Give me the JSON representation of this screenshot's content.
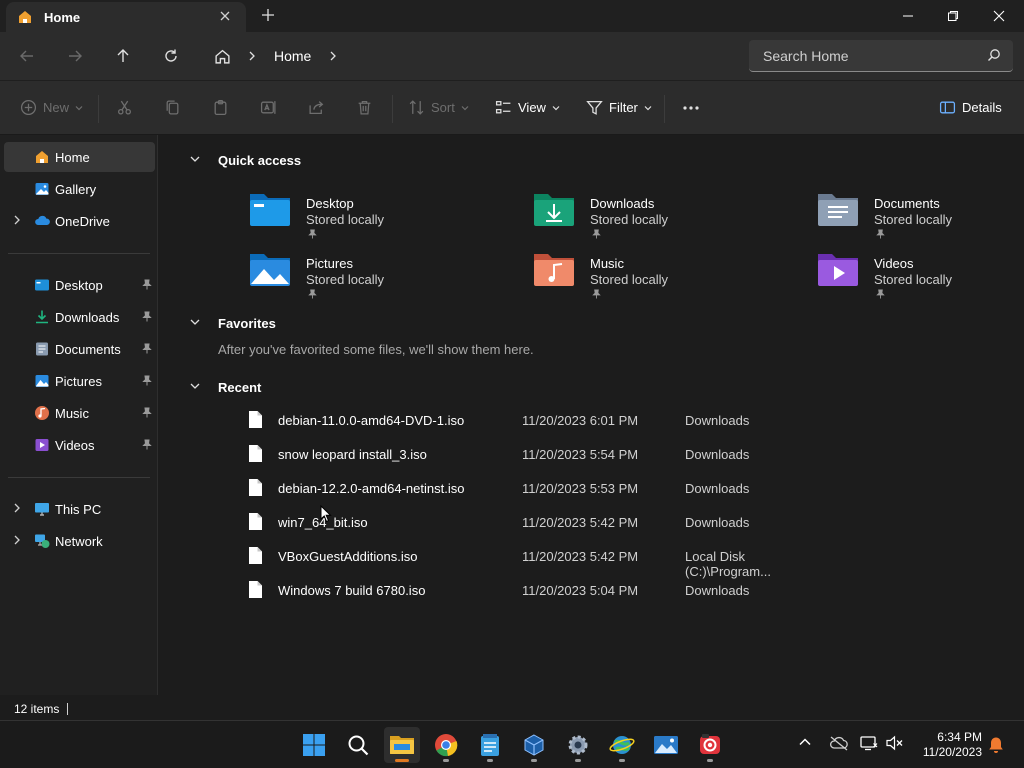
{
  "window": {
    "tab_title": "Home",
    "minimize_label": "",
    "maximize_label": "",
    "close_label": ""
  },
  "address": {
    "breadcrumb_home": "Home",
    "search_placeholder": "Search Home"
  },
  "commands": {
    "new": "New",
    "sort": "Sort",
    "view": "View",
    "filter": "Filter",
    "details": "Details"
  },
  "sidebar": {
    "top": [
      {
        "label": "Home",
        "icon": "home-icon",
        "selected": true
      },
      {
        "label": "Gallery",
        "icon": "gallery-icon"
      },
      {
        "label": "OneDrive",
        "icon": "cloud-icon"
      }
    ],
    "pinned": [
      {
        "label": "Desktop",
        "icon": "desktop-folder-icon"
      },
      {
        "label": "Downloads",
        "icon": "downloads-folder-icon"
      },
      {
        "label": "Documents",
        "icon": "documents-folder-icon"
      },
      {
        "label": "Pictures",
        "icon": "pictures-folder-icon"
      },
      {
        "label": "Music",
        "icon": "music-folder-icon"
      },
      {
        "label": "Videos",
        "icon": "videos-folder-icon"
      }
    ],
    "bottom": [
      {
        "label": "This PC",
        "icon": "computer-icon"
      },
      {
        "label": "Network",
        "icon": "network-icon"
      }
    ]
  },
  "quick_access": {
    "heading": "Quick access",
    "items": [
      {
        "name": "Desktop",
        "status": "Stored locally",
        "icon": "desktop-folder-icon",
        "color": "#1e8fd8"
      },
      {
        "name": "Downloads",
        "status": "Stored locally",
        "icon": "downloads-folder-icon",
        "color": "#1aa37a"
      },
      {
        "name": "Documents",
        "status": "Stored locally",
        "icon": "documents-folder-icon",
        "color": "#8a9bb0"
      },
      {
        "name": "Pictures",
        "status": "Stored locally",
        "icon": "pictures-folder-icon",
        "color": "#2a8be0"
      },
      {
        "name": "Music",
        "status": "Stored locally",
        "icon": "music-folder-icon",
        "color": "#e0704a"
      },
      {
        "name": "Videos",
        "status": "Stored locally",
        "icon": "videos-folder-icon",
        "color": "#8a4fd0"
      }
    ]
  },
  "favorites": {
    "heading": "Favorites",
    "empty_text": "After you've favorited some files, we'll show them here."
  },
  "recent": {
    "heading": "Recent",
    "files": [
      {
        "name": "debian-11.0.0-amd64-DVD-1.iso",
        "date": "11/20/2023 6:01 PM",
        "location": "Downloads"
      },
      {
        "name": "snow leopard install_3.iso",
        "date": "11/20/2023 5:54 PM",
        "location": "Downloads"
      },
      {
        "name": "debian-12.2.0-amd64-netinst.iso",
        "date": "11/20/2023 5:53 PM",
        "location": "Downloads"
      },
      {
        "name": "win7_64_bit.iso",
        "date": "11/20/2023 5:42 PM",
        "location": "Downloads"
      },
      {
        "name": "VBoxGuestAdditions.iso",
        "date": "11/20/2023 5:42 PM",
        "location": "Local Disk (C:)\\Program..."
      },
      {
        "name": "Windows 7 build 6780.iso",
        "date": "11/20/2023 5:04 PM",
        "location": "Downloads"
      }
    ]
  },
  "status": {
    "item_count": "12 items"
  },
  "taskbar": {
    "apps": [
      {
        "name": "start-button",
        "icon": "windows-logo-icon"
      },
      {
        "name": "search-button",
        "icon": "search-icon"
      },
      {
        "name": "file-explorer-app",
        "icon": "folder-icon",
        "active": true
      },
      {
        "name": "chrome-app",
        "icon": "chrome-icon"
      },
      {
        "name": "notepad-app",
        "icon": "notepad-icon"
      },
      {
        "name": "virtualbox-app",
        "icon": "cube-icon"
      },
      {
        "name": "settings-app",
        "icon": "gear-icon"
      },
      {
        "name": "network-app",
        "icon": "globe-icon"
      },
      {
        "name": "photos-app",
        "icon": "image-icon"
      },
      {
        "name": "screen-capture-app",
        "icon": "record-icon"
      }
    ],
    "time": "6:34 PM",
    "date": "11/20/2023"
  },
  "colors": {
    "accent": "#e07820",
    "folder_yellow": "#f0c040",
    "background": "#1c1c1c"
  }
}
